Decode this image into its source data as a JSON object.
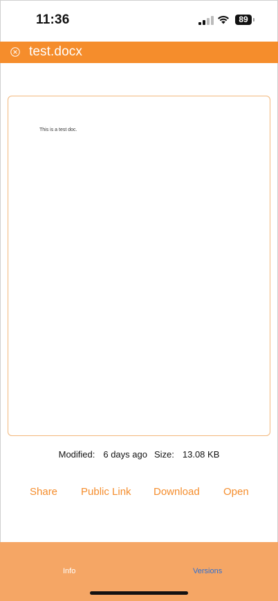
{
  "status_bar": {
    "time": "11:36",
    "battery": "89"
  },
  "header": {
    "title": "test.docx",
    "close_icon": "close-circle-icon"
  },
  "preview": {
    "text": "This is a test doc."
  },
  "meta": {
    "modified_label": "Modified:",
    "modified_value": "6 days ago",
    "size_label": "Size:",
    "size_value": "13.08 KB"
  },
  "actions": {
    "share": "Share",
    "public_link": "Public Link",
    "download": "Download",
    "open": "Open"
  },
  "tabs": {
    "info": "Info",
    "versions": "Versions"
  },
  "colors": {
    "accent": "#f58d2c",
    "tabbar": "#f5a665",
    "active_tab": "#2f6fd1"
  }
}
